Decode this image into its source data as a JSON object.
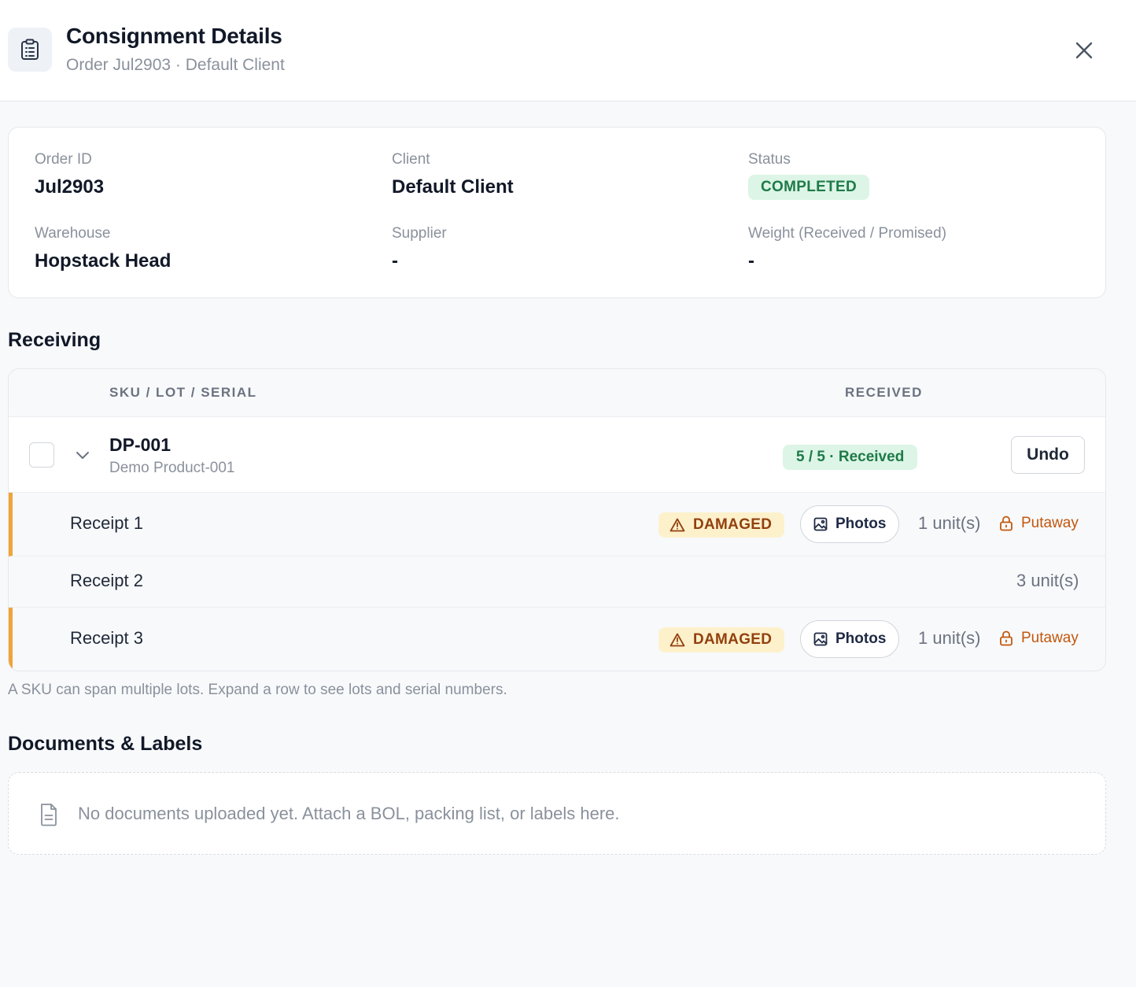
{
  "header": {
    "icon": "clipboard-list-icon",
    "title": "Consignment Details",
    "subtitle": "Order Jul2903 · Default Client",
    "close_icon": "close-icon"
  },
  "summary": {
    "order_id_label": "Order ID",
    "order_id": "Jul2903",
    "client_label": "Client",
    "client": "Default Client",
    "status_label": "Status",
    "status": "COMPLETED",
    "warehouse_label": "Warehouse",
    "warehouse": "Hopstack Head",
    "supplier_label": "Supplier",
    "supplier": "-",
    "weight_label": "Weight (Received / Promised)",
    "weight": "-"
  },
  "receiving": {
    "title": "Receiving",
    "columns": [
      "SKU / LOT / SERIAL",
      "RECEIVED"
    ],
    "sku_row": {
      "code": "DP-001",
      "name": "Demo Product-001",
      "received": "5 / 5 · Received",
      "undo_label": "Undo"
    },
    "receipts": [
      {
        "label": "Receipt 1",
        "damaged": "DAMAGED",
        "photos_label": "Photos",
        "units": "1 unit(s)",
        "putaway_label": "Putaway"
      },
      {
        "label": "Receipt 2",
        "units": "3 unit(s)"
      },
      {
        "label": "Receipt 3",
        "damaged": "DAMAGED",
        "photos_label": "Photos",
        "units": "1 unit(s)",
        "putaway_label": "Putaway"
      }
    ],
    "helper_text": "A SKU can span multiple lots. Expand a row to see lots and serial numbers."
  },
  "documents": {
    "title": "Documents & Labels",
    "empty_text": "No documents uploaded yet. Attach a BOL, packing list, or labels here.",
    "icon": "file-icon"
  },
  "colors": {
    "status_green_bg": "#dcf5e6",
    "status_green_text": "#1f7a48",
    "damaged_bg": "#fdf1cc",
    "damaged_text": "#92400e",
    "putaway_orange": "#c2570c",
    "flag_orange": "#f0a33a"
  }
}
